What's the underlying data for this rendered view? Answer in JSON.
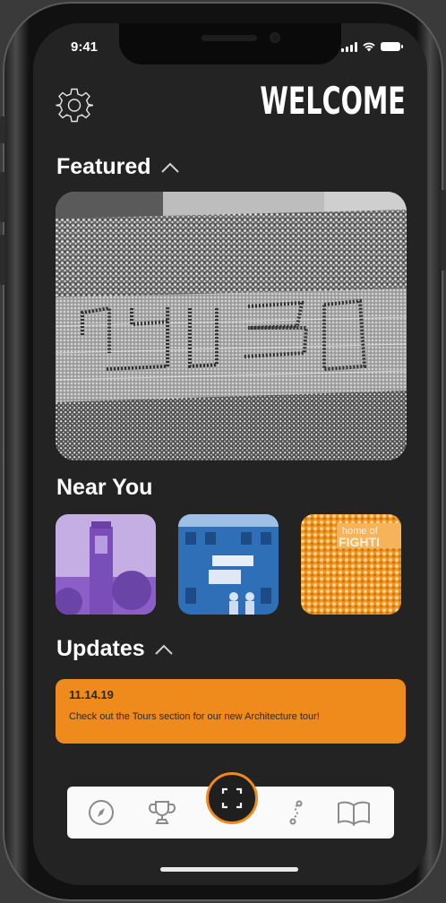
{
  "status_bar": {
    "time": "9:41"
  },
  "header": {
    "title": "WELCOME",
    "settings_icon": "gear-icon"
  },
  "featured": {
    "title": "Featured",
    "toggle_icon": "chevron-up-icon",
    "image_icon": "stadium-photo"
  },
  "near_you": {
    "title": "Near You",
    "items": [
      {
        "image": "bell-tower-photo",
        "tint": "#8b5fc7"
      },
      {
        "image": "building-banner-photo",
        "tint": "#2f6fb8"
      },
      {
        "image": "crowd-photo",
        "tint": "#f0961f",
        "overlay_text": "home of",
        "overlay_text2": "FIGHTI"
      }
    ]
  },
  "updates": {
    "title": "Updates",
    "toggle_icon": "chevron-up-icon",
    "items": [
      {
        "date": "11.14.19",
        "text": "Check out the Tours section for our new Architecture tour!"
      }
    ]
  },
  "tab_bar": {
    "items": [
      {
        "icon": "compass-icon"
      },
      {
        "icon": "trophy-icon"
      },
      {
        "icon": "scan-icon"
      },
      {
        "icon": "route-icon"
      },
      {
        "icon": "book-icon"
      }
    ]
  },
  "colors": {
    "accent": "#ef8a1c",
    "background": "#232323",
    "text": "#ffffff"
  }
}
